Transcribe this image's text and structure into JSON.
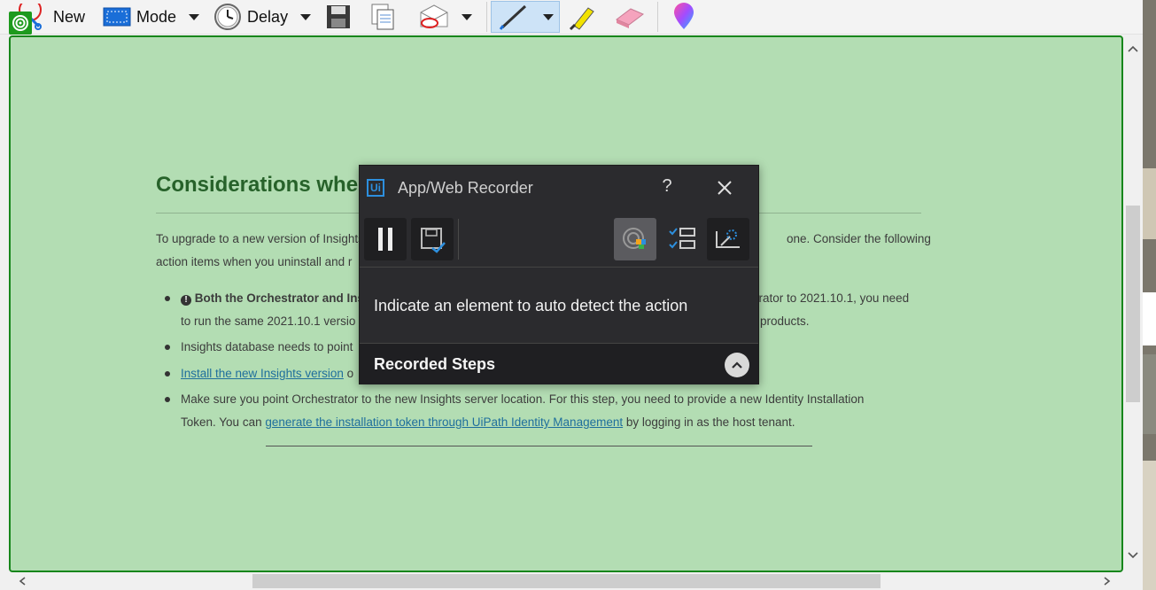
{
  "toolbar": {
    "new_label": "New",
    "mode_label": "Mode",
    "delay_label": "Delay",
    "icons": [
      "new-snip-icon",
      "mode-icon",
      "delay-clock-icon",
      "save-icon",
      "copy-icon",
      "send-icon",
      "pen-icon",
      "highlighter-icon",
      "eraser-icon",
      "paint3d-icon"
    ]
  },
  "page": {
    "heading": "Considerations wher",
    "intro_line1_left": "To upgrade to a new version of Insights",
    "intro_line1_right": "one. Consider the following",
    "intro_line2_left": "action items when you uninstall and r",
    "bullets": [
      {
        "line1_left_bold": "Both the Orchestrator and Ins",
        "line1_right": "strator to 2021.10.1, you need",
        "line2_left": "to run the same 2021.10.1 versio",
        "line2_right": "products."
      },
      {
        "line1_left": "Insights database needs to point"
      },
      {
        "link": "Install the new Insights version",
        "rest": " o"
      },
      {
        "line1": "Make sure you point Orchestrator to the new Insights server location. For this step, you need to provide a new Identity Installation",
        "line2_prefix": "Token. You can ",
        "line2_link": "generate the installation token through UiPath Identity Management",
        "line2_suffix": " by logging in as the host tenant."
      }
    ]
  },
  "recorder": {
    "logo": "Ui",
    "title": "App/Web Recorder",
    "help": "?",
    "hint": "Indicate an element to auto detect the action",
    "recorded_steps": "Recorded Steps"
  },
  "colors": {
    "selection_fill": "#b3ddb3",
    "selection_border": "#17861b",
    "heading": "#27622a",
    "link": "#1f6f9c",
    "recorder_bg": "#2b2b2e",
    "recorder_accent": "#2d8fde"
  }
}
